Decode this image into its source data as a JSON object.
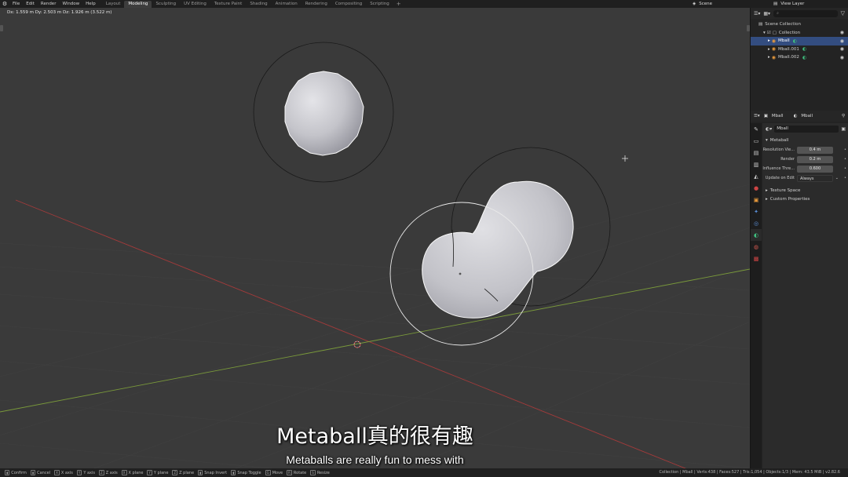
{
  "topbar": {
    "menus": [
      "File",
      "Edit",
      "Render",
      "Window",
      "Help"
    ],
    "workspaces": [
      "Layout",
      "Modeling",
      "Sculpting",
      "UV Editing",
      "Texture Paint",
      "Shading",
      "Animation",
      "Rendering",
      "Compositing",
      "Scripting"
    ],
    "active_workspace": "Modeling",
    "scene_label": "Scene",
    "view_layer_label": "View Layer"
  },
  "viewport": {
    "hud_text": "Dx: 1.559 m   Dy: 2.503 m   Dz: 1.926 m (3.522 m)",
    "subtitle_main": "Metaball真的很有趣",
    "subtitle_sub": "Metaballs are really fun to mess with"
  },
  "outliner": {
    "rows": [
      {
        "label": "Scene Collection",
        "indent": 0
      },
      {
        "label": "Collection",
        "indent": 1
      },
      {
        "label": "Mball",
        "indent": 2,
        "selected": true
      },
      {
        "label": "Mball.001",
        "indent": 2
      },
      {
        "label": "Mball.002",
        "indent": 2
      }
    ]
  },
  "properties": {
    "header_object": "Mball",
    "header_data": "Mball",
    "datablock_name": "Mball",
    "panel_title": "Metaball",
    "fields": [
      {
        "label": "Resolution Vie...",
        "value": "0.4 m"
      },
      {
        "label": "Render",
        "value": "0.2 m"
      },
      {
        "label": "Influence Thre...",
        "value": "0.600"
      },
      {
        "label": "Update on Edit",
        "value": "Always",
        "dropdown": true
      }
    ],
    "collapsed_sections": [
      "Texture Space",
      "Custom Properties"
    ]
  },
  "statusbar": {
    "items": [
      {
        "key": "",
        "label": "Confirm"
      },
      {
        "key": "",
        "label": "Cancel"
      },
      {
        "key": "X",
        "label": "X axis"
      },
      {
        "key": "Y",
        "label": "Y axis"
      },
      {
        "key": "Z",
        "label": "Z axis"
      },
      {
        "key": "X",
        "label": "X plane"
      },
      {
        "key": "Y",
        "label": "Y plane"
      },
      {
        "key": "Z",
        "label": "Z plane"
      },
      {
        "key": "",
        "label": "Snap Invert"
      },
      {
        "key": "",
        "label": "Snap Toggle"
      },
      {
        "key": "G",
        "label": "Move"
      },
      {
        "key": "R",
        "label": "Rotate"
      },
      {
        "key": "S",
        "label": "Resize"
      }
    ],
    "stats": "Collection | Mball | Verts:438 | Faces:527 | Tris:1,054 | Objects:1/3 | Mem: 43.5 MiB | v2.82.6"
  },
  "colors": {
    "viewport_bg": "#3a3a3a",
    "selection_blue": "#334d80",
    "x_axis_red": "#a33a3a",
    "y_axis_green": "#7a9a3a",
    "metaball_fill": "#c9c9cf"
  }
}
